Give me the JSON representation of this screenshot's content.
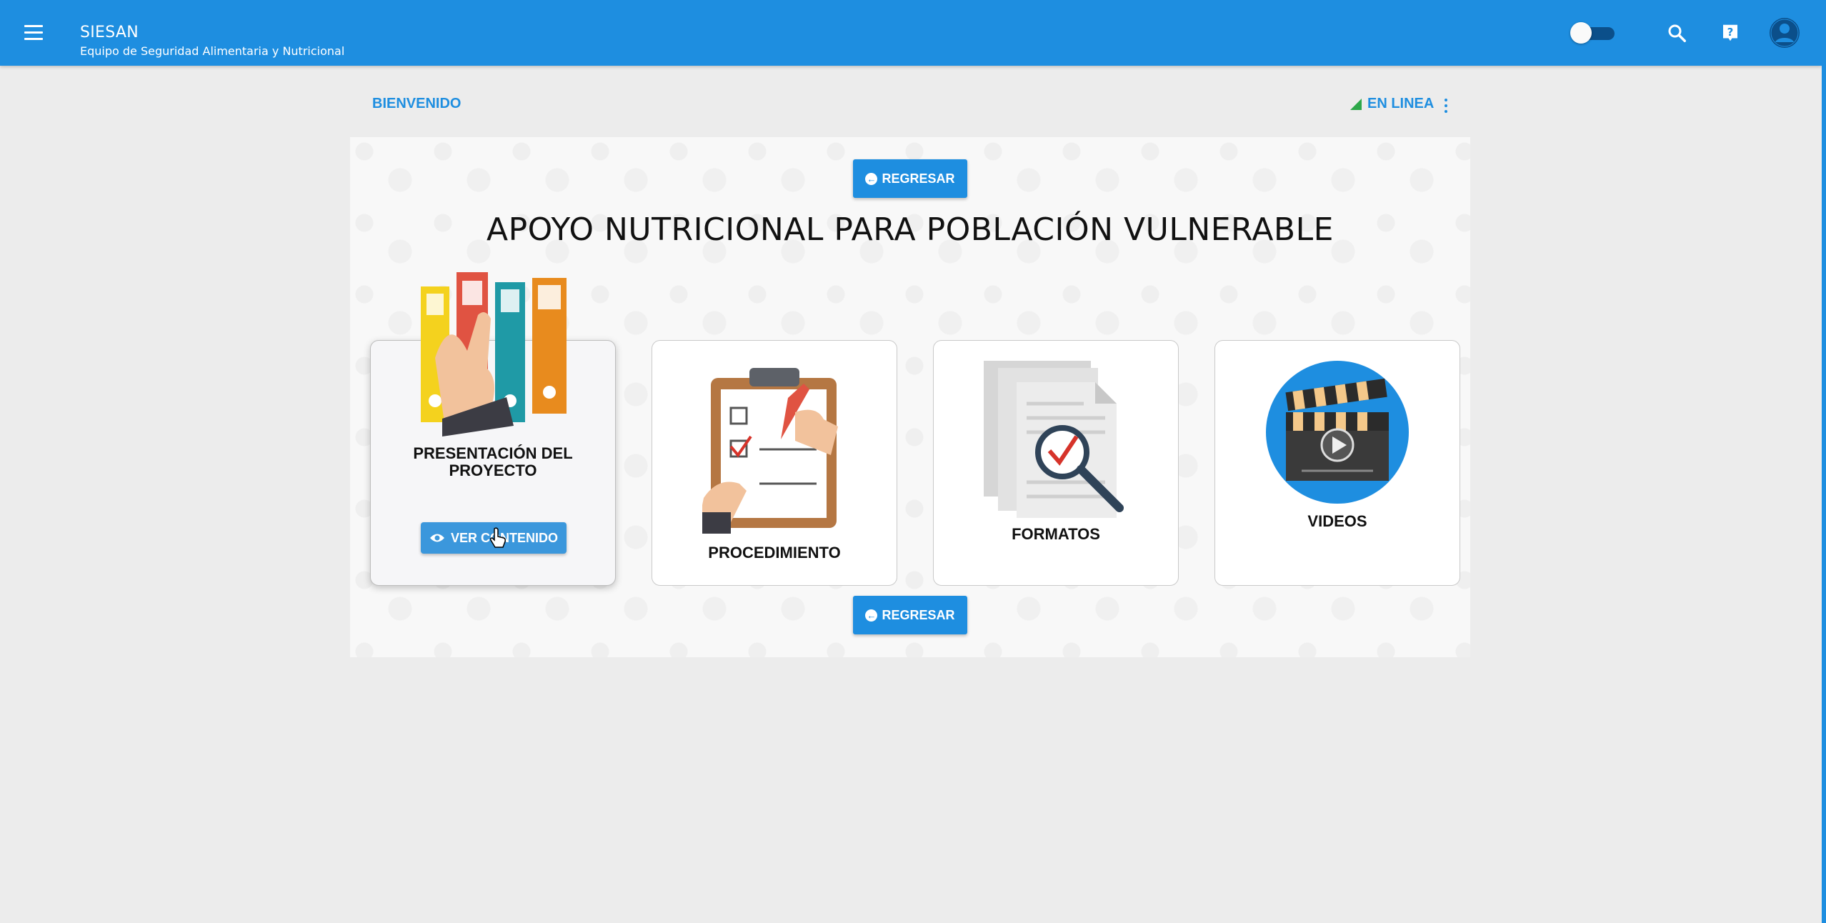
{
  "app": {
    "title": "SIESAN",
    "subtitle": "Equipo de Seguridad Alimentaria y Nutricional"
  },
  "topbar": {
    "icons": [
      "menu-icon",
      "theme-toggle",
      "search-icon",
      "help-icon",
      "account-icon"
    ],
    "toggle_state": "off"
  },
  "header": {
    "welcome": "BIENVENIDO",
    "status": "EN LINEA",
    "status_color": "#2ea84a"
  },
  "main": {
    "back_label": "REGRESAR",
    "title": "APOYO NUTRICIONAL PARA POBLACIÓN VULNERABLE",
    "cards": [
      {
        "label": "PRESENTACIÓN DEL PROYECTO",
        "icon": "binders-icon",
        "button": "VER CONTENIDO"
      },
      {
        "label": "PROCEDIMIENTO",
        "icon": "clipboard-checklist-icon"
      },
      {
        "label": "FORMATOS",
        "icon": "documents-magnifier-icon"
      },
      {
        "label": "VIDEOS",
        "icon": "clapperboard-icon"
      }
    ]
  },
  "colors": {
    "primary": "#1e8ee0",
    "background": "#ececec"
  }
}
